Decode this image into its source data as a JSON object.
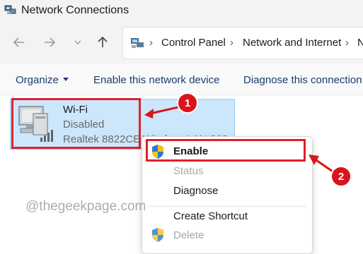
{
  "window": {
    "title": "Network Connections",
    "icon": "network-connections-icon"
  },
  "nav": {
    "back_icon": "arrow-left-icon",
    "forward_icon": "arrow-right-icon",
    "up_icon": "arrow-up-icon",
    "breadcrumbs": [
      "Control Panel",
      "Network and Internet",
      "N"
    ]
  },
  "toolbar": {
    "organize_label": "Organize",
    "enable_label": "Enable this network device",
    "diagnose_label": "Diagnose this connection"
  },
  "adapter": {
    "name": "Wi-Fi",
    "status": "Disabled",
    "device": "Realtek 8822CE",
    "device_tail": "Wireless LAN 802"
  },
  "context_menu": {
    "items": [
      {
        "label": "Enable",
        "enabled": true,
        "bold": true,
        "icon": "shield-icon"
      },
      {
        "label": "Status",
        "enabled": false
      },
      {
        "label": "Diagnose",
        "enabled": true
      },
      {
        "label": "Create Shortcut",
        "enabled": true
      },
      {
        "label": "Delete",
        "enabled": false,
        "icon": "shield-icon"
      }
    ]
  },
  "annotations": {
    "step1": "1",
    "step2": "2"
  },
  "watermark": "@thegeekpage.com",
  "colors": {
    "highlight_red": "#e0202a",
    "selection_blue": "#cce6fb",
    "command_text": "#1a3c73"
  }
}
